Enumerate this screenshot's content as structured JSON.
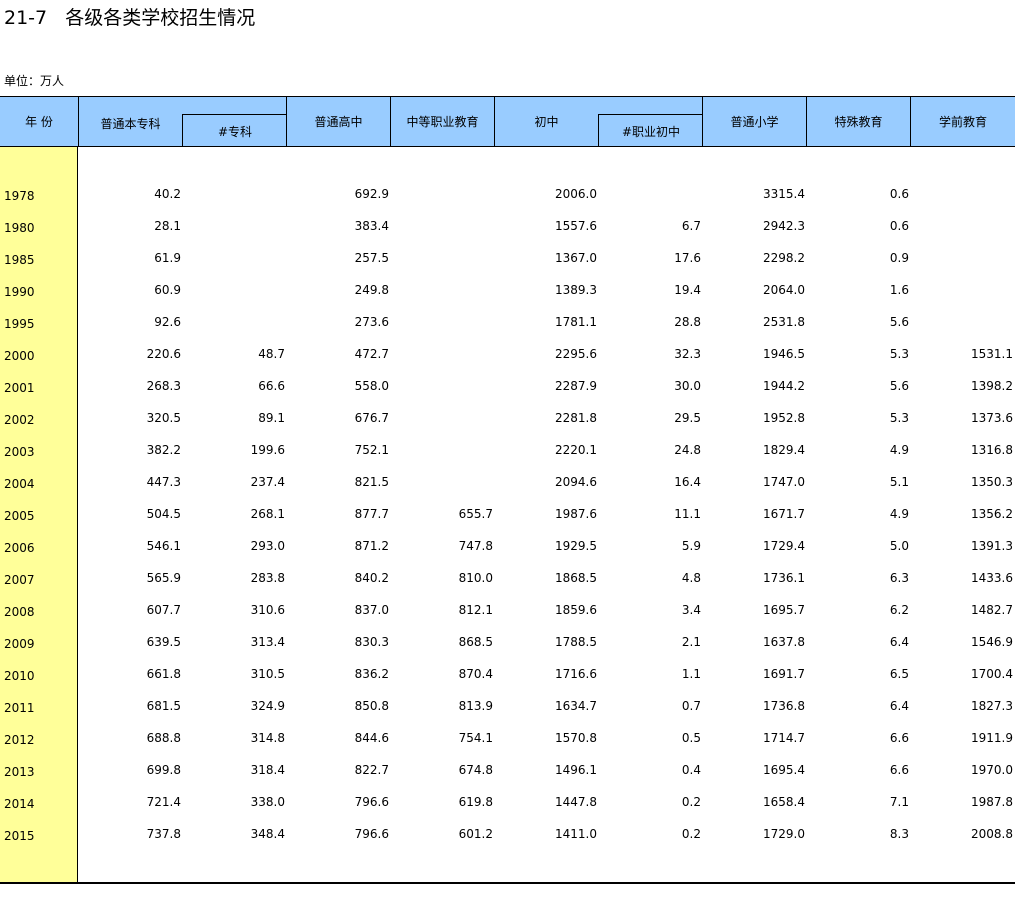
{
  "title": "21-7   各级各类学校招生情况",
  "unit": "单位：万人",
  "headers": {
    "year": "年  份",
    "undergrad": "普通本专科",
    "college": "#专科",
    "high_school": "普通高中",
    "vocational": "中等职业教育",
    "junior": "初中",
    "vocational_junior": "#职业初中",
    "primary": "普通小学",
    "special": "特殊教育",
    "preschool": "学前教育"
  },
  "rows": [
    {
      "year": "1978",
      "undergrad": "40.2",
      "college": "",
      "high_school": "692.9",
      "vocational": "",
      "junior": "2006.0",
      "vocational_junior": "",
      "primary": "3315.4",
      "special": "0.6",
      "preschool": ""
    },
    {
      "year": "1980",
      "undergrad": "28.1",
      "college": "",
      "high_school": "383.4",
      "vocational": "",
      "junior": "1557.6",
      "vocational_junior": "6.7",
      "primary": "2942.3",
      "special": "0.6",
      "preschool": ""
    },
    {
      "year": "1985",
      "undergrad": "61.9",
      "college": "",
      "high_school": "257.5",
      "vocational": "",
      "junior": "1367.0",
      "vocational_junior": "17.6",
      "primary": "2298.2",
      "special": "0.9",
      "preschool": ""
    },
    {
      "year": "1990",
      "undergrad": "60.9",
      "college": "",
      "high_school": "249.8",
      "vocational": "",
      "junior": "1389.3",
      "vocational_junior": "19.4",
      "primary": "2064.0",
      "special": "1.6",
      "preschool": ""
    },
    {
      "year": "1995",
      "undergrad": "92.6",
      "college": "",
      "high_school": "273.6",
      "vocational": "",
      "junior": "1781.1",
      "vocational_junior": "28.8",
      "primary": "2531.8",
      "special": "5.6",
      "preschool": ""
    },
    {
      "year": "2000",
      "undergrad": "220.6",
      "college": "48.7",
      "high_school": "472.7",
      "vocational": "",
      "junior": "2295.6",
      "vocational_junior": "32.3",
      "primary": "1946.5",
      "special": "5.3",
      "preschool": "1531.1"
    },
    {
      "year": "2001",
      "undergrad": "268.3",
      "college": "66.6",
      "high_school": "558.0",
      "vocational": "",
      "junior": "2287.9",
      "vocational_junior": "30.0",
      "primary": "1944.2",
      "special": "5.6",
      "preschool": "1398.2"
    },
    {
      "year": "2002",
      "undergrad": "320.5",
      "college": "89.1",
      "high_school": "676.7",
      "vocational": "",
      "junior": "2281.8",
      "vocational_junior": "29.5",
      "primary": "1952.8",
      "special": "5.3",
      "preschool": "1373.6"
    },
    {
      "year": "2003",
      "undergrad": "382.2",
      "college": "199.6",
      "high_school": "752.1",
      "vocational": "",
      "junior": "2220.1",
      "vocational_junior": "24.8",
      "primary": "1829.4",
      "special": "4.9",
      "preschool": "1316.8"
    },
    {
      "year": "2004",
      "undergrad": "447.3",
      "college": "237.4",
      "high_school": "821.5",
      "vocational": "",
      "junior": "2094.6",
      "vocational_junior": "16.4",
      "primary": "1747.0",
      "special": "5.1",
      "preschool": "1350.3"
    },
    {
      "year": "2005",
      "undergrad": "504.5",
      "college": "268.1",
      "high_school": "877.7",
      "vocational": "655.7",
      "junior": "1987.6",
      "vocational_junior": "11.1",
      "primary": "1671.7",
      "special": "4.9",
      "preschool": "1356.2"
    },
    {
      "year": "2006",
      "undergrad": "546.1",
      "college": "293.0",
      "high_school": "871.2",
      "vocational": "747.8",
      "junior": "1929.5",
      "vocational_junior": "5.9",
      "primary": "1729.4",
      "special": "5.0",
      "preschool": "1391.3"
    },
    {
      "year": "2007",
      "undergrad": "565.9",
      "college": "283.8",
      "high_school": "840.2",
      "vocational": "810.0",
      "junior": "1868.5",
      "vocational_junior": "4.8",
      "primary": "1736.1",
      "special": "6.3",
      "preschool": "1433.6"
    },
    {
      "year": "2008",
      "undergrad": "607.7",
      "college": "310.6",
      "high_school": "837.0",
      "vocational": "812.1",
      "junior": "1859.6",
      "vocational_junior": "3.4",
      "primary": "1695.7",
      "special": "6.2",
      "preschool": "1482.7"
    },
    {
      "year": "2009",
      "undergrad": "639.5",
      "college": "313.4",
      "high_school": "830.3",
      "vocational": "868.5",
      "junior": "1788.5",
      "vocational_junior": "2.1",
      "primary": "1637.8",
      "special": "6.4",
      "preschool": "1546.9"
    },
    {
      "year": "2010",
      "undergrad": "661.8",
      "college": "310.5",
      "high_school": "836.2",
      "vocational": "870.4",
      "junior": "1716.6",
      "vocational_junior": "1.1",
      "primary": "1691.7",
      "special": "6.5",
      "preschool": "1700.4"
    },
    {
      "year": "2011",
      "undergrad": "681.5",
      "college": "324.9",
      "high_school": "850.8",
      "vocational": "813.9",
      "junior": "1634.7",
      "vocational_junior": "0.7",
      "primary": "1736.8",
      "special": "6.4",
      "preschool": "1827.3"
    },
    {
      "year": "2012",
      "undergrad": "688.8",
      "college": "314.8",
      "high_school": "844.6",
      "vocational": "754.1",
      "junior": "1570.8",
      "vocational_junior": "0.5",
      "primary": "1714.7",
      "special": "6.6",
      "preschool": "1911.9"
    },
    {
      "year": "2013",
      "undergrad": "699.8",
      "college": "318.4",
      "high_school": "822.7",
      "vocational": "674.8",
      "junior": "1496.1",
      "vocational_junior": "0.4",
      "primary": "1695.4",
      "special": "6.6",
      "preschool": "1970.0"
    },
    {
      "year": "2014",
      "undergrad": "721.4",
      "college": "338.0",
      "high_school": "796.6",
      "vocational": "619.8",
      "junior": "1447.8",
      "vocational_junior": "0.2",
      "primary": "1658.4",
      "special": "7.1",
      "preschool": "1987.8"
    },
    {
      "year": "2015",
      "undergrad": "737.8",
      "college": "348.4",
      "high_school": "796.6",
      "vocational": "601.2",
      "junior": "1411.0",
      "vocational_junior": "0.2",
      "primary": "1729.0",
      "special": "8.3",
      "preschool": "2008.8"
    }
  ],
  "colors": {
    "header_bg": "#99ccff",
    "year_col_bg": "#ffff99"
  }
}
